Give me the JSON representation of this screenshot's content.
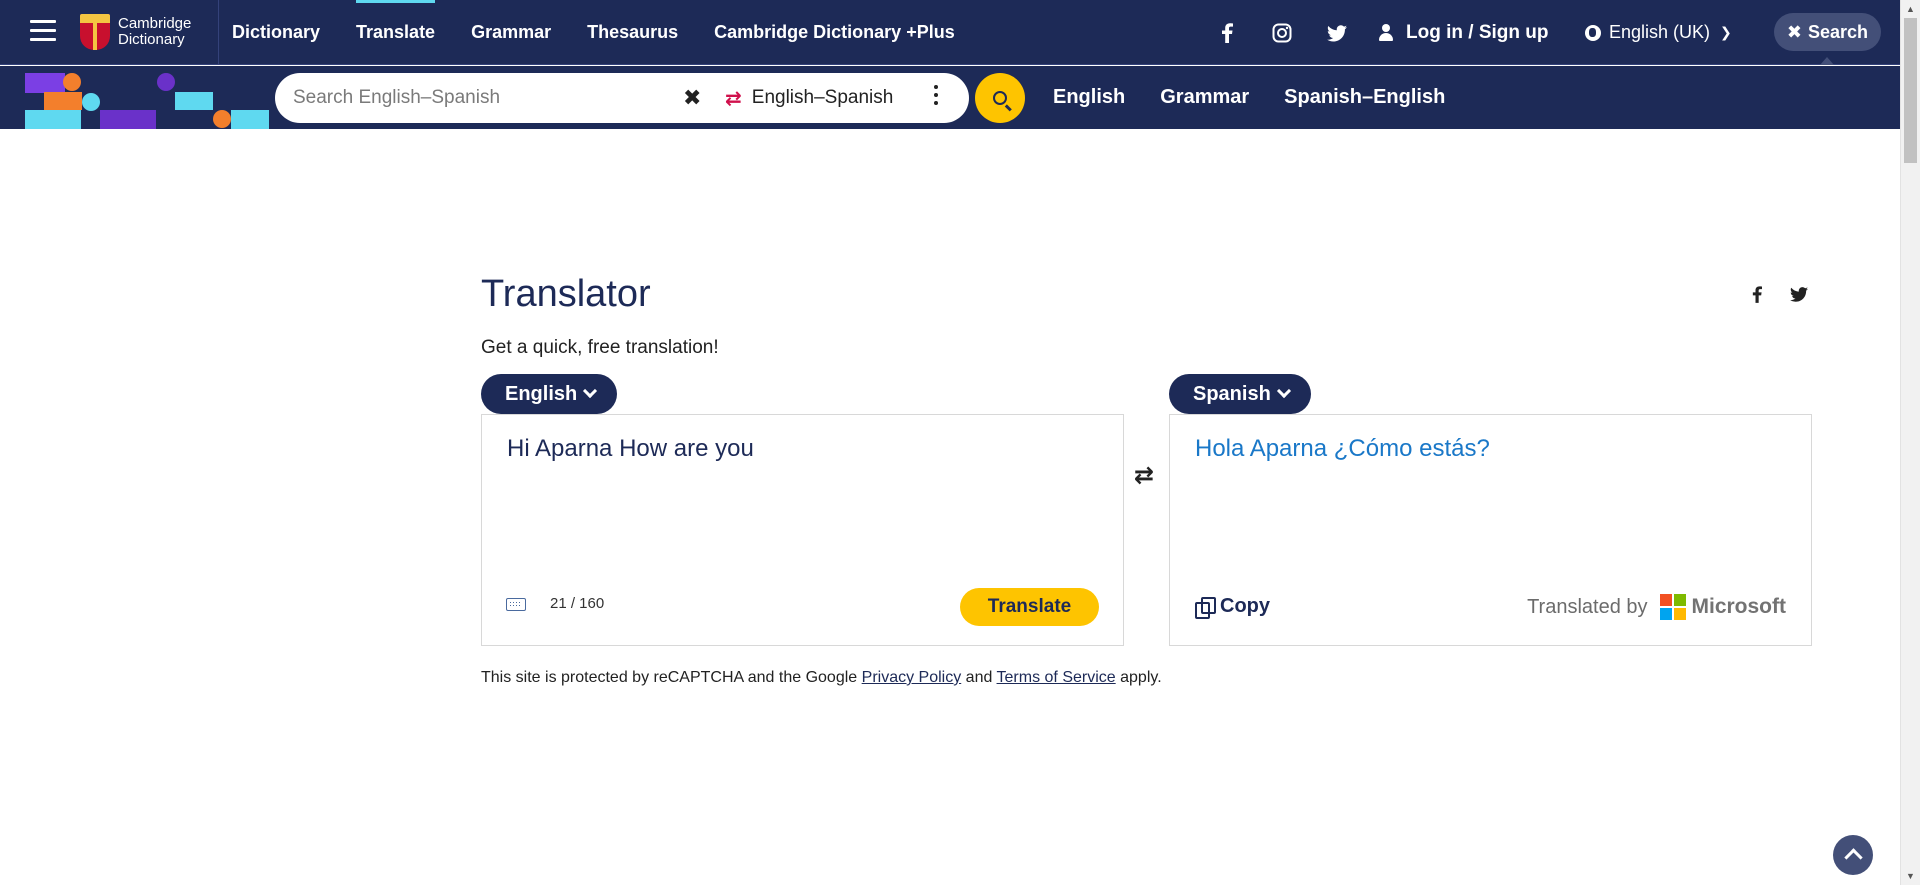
{
  "header": {
    "brand": "Cambridge Dictionary",
    "nav": [
      "Dictionary",
      "Translate",
      "Grammar",
      "Thesaurus",
      "Cambridge Dictionary +Plus"
    ],
    "social_icons": [
      "facebook-icon",
      "instagram-icon",
      "twitter-icon"
    ],
    "login_label": "Log in / Sign up",
    "language": "English (UK)",
    "search_pill": "Search"
  },
  "searchbar": {
    "placeholder": "Search English–Spanish",
    "dictionary": "English–Spanish",
    "links": [
      "English",
      "Grammar",
      "Spanish–English"
    ]
  },
  "translator": {
    "title": "Translator",
    "subtitle": "Get a quick, free translation!",
    "source_lang": "English",
    "target_lang": "Spanish",
    "source_text": "Hi Aparna How are you",
    "char_count": "21 / 160",
    "translate_label": "Translate",
    "result_text": "Hola Aparna ¿Cómo estás?",
    "copy_label": "Copy",
    "translated_by": "Translated by",
    "provider": "Microsoft"
  },
  "footer_note": {
    "prefix": "This site is protected by reCAPTCHA and the Google",
    "privacy": "Privacy Policy",
    "and": "and",
    "terms": "Terms of Service",
    "suffix": "apply."
  },
  "colors": {
    "navy": "#1d2a57",
    "yellow": "#fec400",
    "link_blue": "#1a78c8",
    "accent_cyan": "#5fd9f0"
  }
}
